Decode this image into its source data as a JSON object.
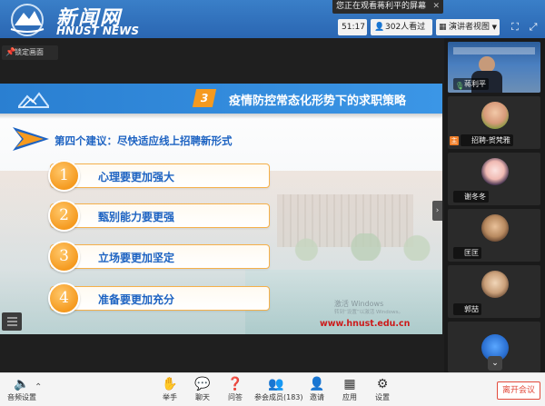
{
  "banner": {
    "title_cn": "新闻网",
    "title_en": "HNUST NEWS"
  },
  "notice": {
    "text": "您正在观看蒋利平的屏幕"
  },
  "topbar": {
    "time": "51:17",
    "viewers": "302人看过",
    "view_mode": "演讲者视图"
  },
  "lock": {
    "label": "锁定画面"
  },
  "slide": {
    "section_number": "3",
    "header_title": "疫情防控常态化形势下的求职策略",
    "subtitle": "第四个建议：尽快适应线上招聘新形式",
    "items": [
      {
        "num": "1",
        "text": "心理要更加强大"
      },
      {
        "num": "2",
        "text": "甄别能力要更强"
      },
      {
        "num": "3",
        "text": "立场要更加坚定"
      },
      {
        "num": "4",
        "text": "准备要更加充分"
      }
    ],
    "watermark_line1": "激活 Windows",
    "watermark_line2": "转到“设置”以激活 Windows。",
    "url": "www.hnust.edu.cn"
  },
  "participants": [
    {
      "name": "蒋利平",
      "kind": "video"
    },
    {
      "name": "招聘-贺梵雅",
      "kind": "avatar",
      "host": true
    },
    {
      "name": "谢冬冬",
      "kind": "avatar"
    },
    {
      "name": "匡匡",
      "kind": "avatar"
    },
    {
      "name": "郭喆",
      "kind": "avatar"
    },
    {
      "name": "",
      "kind": "avatar"
    }
  ],
  "toolbar": {
    "audio": "音频设置",
    "raise_hand": "举手",
    "chat": "聊天",
    "qa": "问答",
    "members": "参会成员(183)",
    "invite": "邀请",
    "apps": "应用",
    "settings": "设置",
    "leave": "离开会议"
  },
  "colors": {
    "accent": "#1d63c2",
    "orange": "#f59a1f",
    "leave": "#e24a3b",
    "banner": "#2f74c0"
  }
}
